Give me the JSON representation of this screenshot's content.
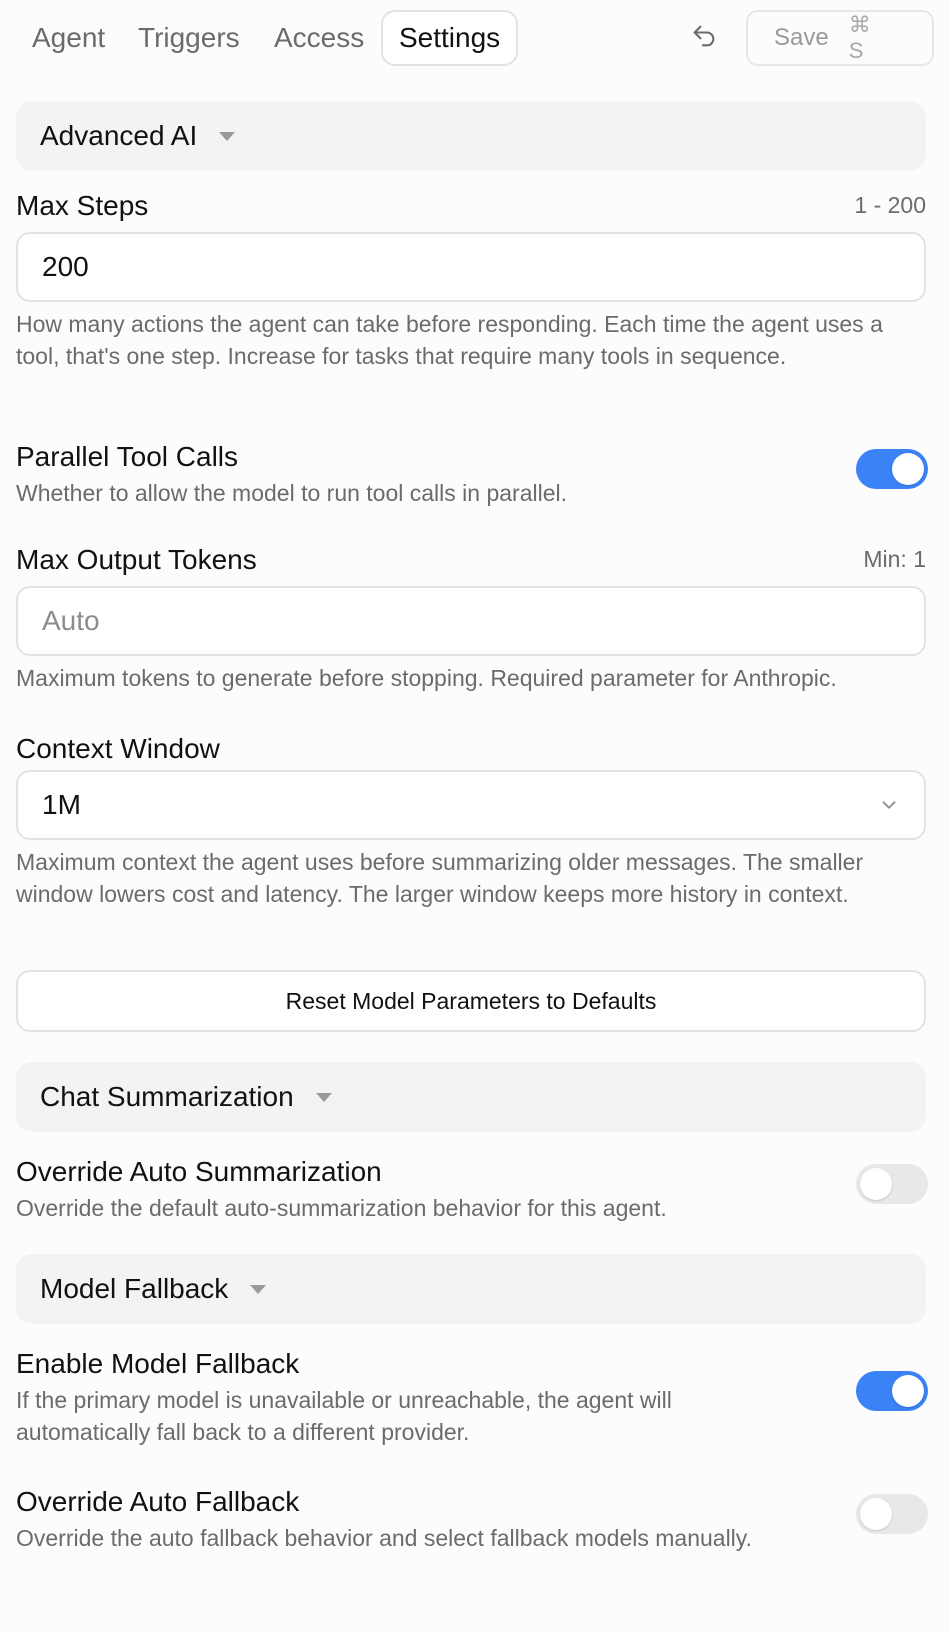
{
  "tabs": [
    {
      "label": "Agent",
      "active": false
    },
    {
      "label": "Triggers",
      "active": false
    },
    {
      "label": "Access",
      "active": false
    },
    {
      "label": "Settings",
      "active": true
    }
  ],
  "toolbar": {
    "undo_icon": "undo-icon",
    "save_label": "Save",
    "save_shortcut": "⌘ S"
  },
  "advanced_ai": {
    "section_title": "Advanced AI",
    "max_steps": {
      "label": "Max Steps",
      "range": "1 - 200",
      "value": "200",
      "description": "How many actions the agent can take before responding. Each time the agent uses a tool, that's one step. Increase for tasks that require many tools in sequence."
    },
    "parallel_tool_calls": {
      "label": "Parallel Tool Calls",
      "description": "Whether to allow the model to run tool calls in parallel.",
      "enabled": true
    },
    "max_output_tokens": {
      "label": "Max Output Tokens",
      "range": "Min: 1",
      "value": "",
      "placeholder": "Auto",
      "description": "Maximum tokens to generate before stopping. Required parameter for Anthropic."
    },
    "context_window": {
      "label": "Context Window",
      "selected": "1M",
      "description": "Maximum context the agent uses before summarizing older messages. The smaller window lowers cost and latency. The larger window keeps more history in context."
    },
    "reset_label": "Reset Model Parameters to Defaults"
  },
  "chat_summarization": {
    "section_title": "Chat Summarization",
    "override_auto_summarization": {
      "label": "Override Auto Summarization",
      "description": "Override the default auto-summarization behavior for this agent.",
      "enabled": false
    }
  },
  "model_fallback": {
    "section_title": "Model Fallback",
    "enable_model_fallback": {
      "label": "Enable Model Fallback",
      "description": "If the primary model is unavailable or unreachable, the agent will automatically fall back to a different provider.",
      "enabled": true
    },
    "override_auto_fallback": {
      "label": "Override Auto Fallback",
      "description": "Override the auto fallback behavior and select fallback models manually.",
      "enabled": false
    }
  },
  "colors": {
    "accent": "#3b82f6",
    "toggle_off": "#e8e8ea",
    "section_bg": "#f3f3f3",
    "muted_text": "#6b6b6b"
  }
}
